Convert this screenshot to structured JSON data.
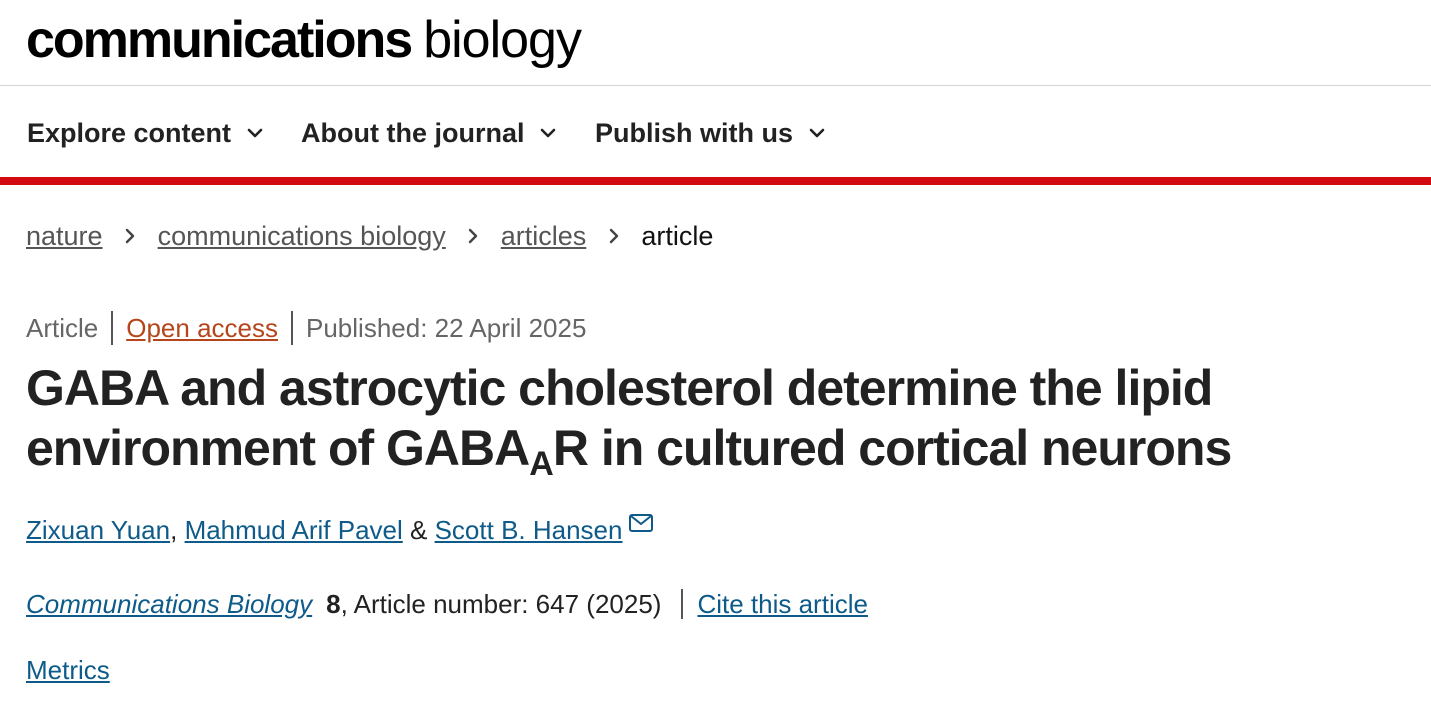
{
  "header": {
    "brand_bold": "communications",
    "brand_light": "biology"
  },
  "nav": {
    "items": [
      {
        "label": "Explore content"
      },
      {
        "label": "About the journal"
      },
      {
        "label": "Publish with us"
      }
    ]
  },
  "breadcrumb": {
    "items": [
      "nature",
      "communications biology",
      "articles"
    ],
    "current": "article"
  },
  "article": {
    "type": "Article",
    "access": "Open access",
    "published": "Published: 22 April 2025",
    "title_part1": "GABA and astrocytic cholesterol determine the lipid environment of GABA",
    "title_sub": "A",
    "title_part2": "R in cultured cortical neurons",
    "authors": [
      {
        "name": "Zixuan Yuan"
      },
      {
        "name": "Mahmud Arif Pavel"
      },
      {
        "name": "Scott B. Hansen"
      }
    ],
    "author_sep_comma": ",",
    "author_sep_amp": "&",
    "journal": "Communications Biology",
    "volume": "8",
    "article_number": ", Article number: 647 (2025)",
    "cite_label": "Cite this article",
    "metrics_label": "Metrics"
  },
  "colors": {
    "accent_red": "#d20a11",
    "link_blue": "#0e5b8a",
    "open_access_orange": "#b5461c"
  },
  "icons": {
    "nav_chevron": "chevron-down-icon",
    "breadcrumb_sep": "chevron-right-icon",
    "email": "mail-icon"
  }
}
